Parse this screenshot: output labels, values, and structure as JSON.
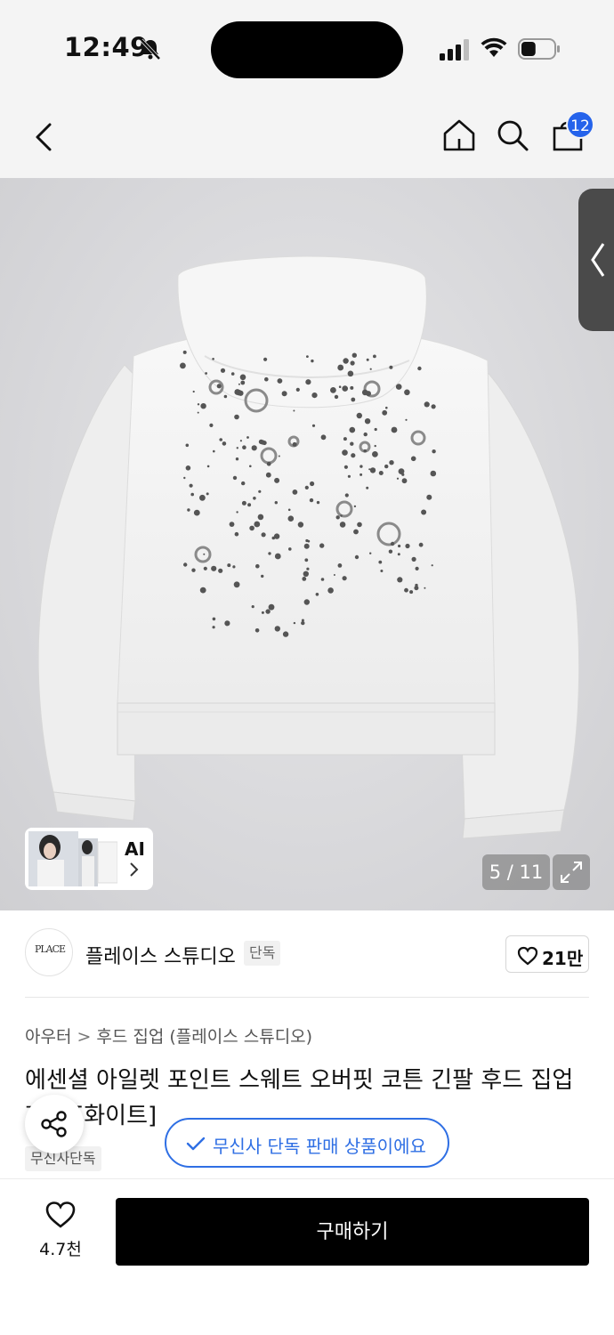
{
  "status": {
    "time": "12:49",
    "battery_level": 0.45
  },
  "header": {
    "cart_count": "12"
  },
  "gallery": {
    "ai_label": "AI",
    "counter": "5 / 11"
  },
  "brand": {
    "name": "플레이스 스튜디오",
    "logo_text": "PLACE",
    "exclusive_label": "단독",
    "likes": "21만"
  },
  "breadcrumb": {
    "category": "아우터",
    "separator": ">",
    "subcategory": "후드 집업 (플레이스 스튜디오)"
  },
  "product": {
    "title": "에센셜 아일렛 포인트 스웨트 오버핏 코튼 긴팔 후드 집업 자켓 [화이트]",
    "tag": "무신사단독"
  },
  "toast": {
    "message": "무신사 단독 판매 상품이에요"
  },
  "bottom": {
    "wish_count": "4.7천",
    "buy_label": "구매하기"
  },
  "colors": {
    "accent": "#2563eb",
    "toast_blue": "#2f6fe4",
    "buy_bg": "#000000"
  }
}
